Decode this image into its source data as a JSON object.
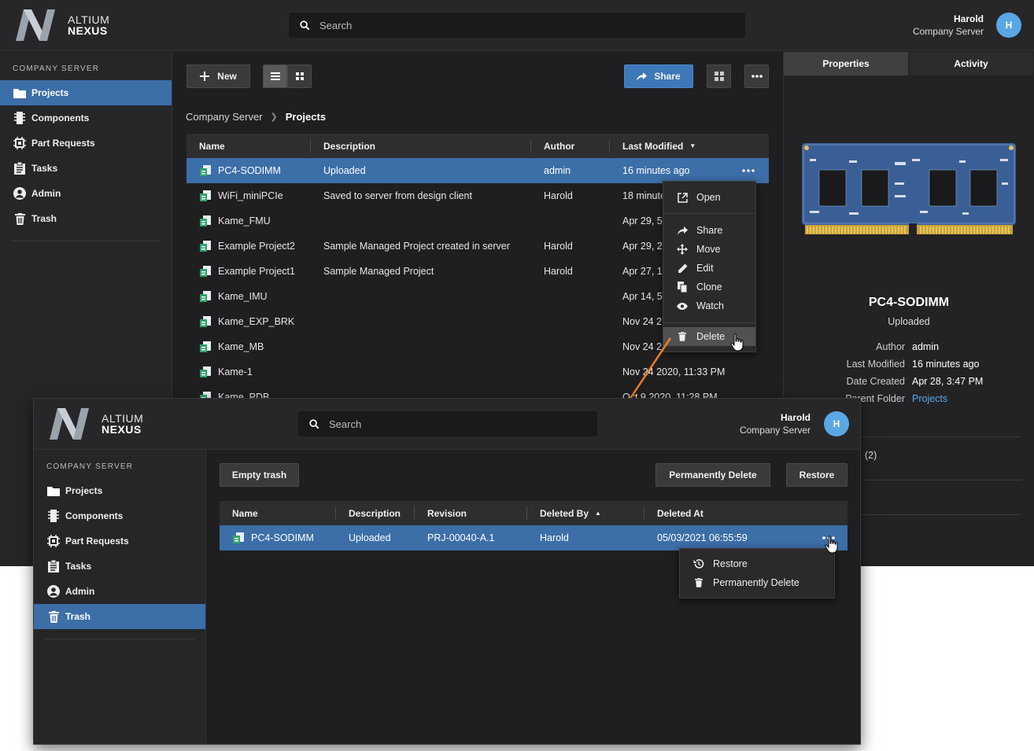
{
  "brand": {
    "line1": "ALTIUM",
    "line2": "NEXUS"
  },
  "search": {
    "placeholder": "Search"
  },
  "user": {
    "name": "Harold",
    "org": "Company Server",
    "initial": "H"
  },
  "sidebar": {
    "section": "COMPANY SERVER",
    "items": [
      {
        "label": "Projects",
        "icon": "folder-icon"
      },
      {
        "label": "Components",
        "icon": "chip-icon"
      },
      {
        "label": "Part Requests",
        "icon": "part-request-icon"
      },
      {
        "label": "Tasks",
        "icon": "clipboard-icon"
      },
      {
        "label": "Admin",
        "icon": "user-circle-icon"
      },
      {
        "label": "Trash",
        "icon": "trash-icon"
      }
    ]
  },
  "projects_view": {
    "toolbar": {
      "new_label": "New",
      "share_label": "Share"
    },
    "breadcrumb": {
      "root": "Company Server",
      "current": "Projects"
    },
    "columns": [
      "Name",
      "Description",
      "Author",
      "Last Modified"
    ],
    "rows": [
      {
        "name": "PC4-SODIMM",
        "description": "Uploaded",
        "author": "admin",
        "modified": "16 minutes ago"
      },
      {
        "name": "WiFi_miniPCIe",
        "description": "Saved to server from design client",
        "author": "Harold",
        "modified": "18 minutes ago"
      },
      {
        "name": "Kame_FMU",
        "description": "",
        "author": "",
        "modified": "Apr 29, 5"
      },
      {
        "name": "Example Project2",
        "description": "Sample Managed Project created in server",
        "author": "Harold",
        "modified": "Apr 29, 2"
      },
      {
        "name": "Example Project1",
        "description": "Sample Managed Project",
        "author": "Harold",
        "modified": "Apr 27, 1"
      },
      {
        "name": "Kame_IMU",
        "description": "",
        "author": "",
        "modified": "Apr 14, 5"
      },
      {
        "name": "Kame_EXP_BRK",
        "description": "",
        "author": "",
        "modified": "Nov 24 2"
      },
      {
        "name": "Kame_MB",
        "description": "",
        "author": "",
        "modified": "Nov 24 2"
      },
      {
        "name": "Kame-1",
        "description": "",
        "author": "",
        "modified": "Nov 24 2020, 11:33 PM"
      },
      {
        "name": "Kame_PDB",
        "description": "",
        "author": "",
        "modified": "Oct 9 2020, 11:28 PM"
      }
    ],
    "context_menu": [
      "Open",
      "Share",
      "Move",
      "Edit",
      "Clone",
      "Watch",
      "Delete"
    ]
  },
  "properties": {
    "tabs": [
      "Properties",
      "Activity"
    ],
    "name": "PC4-SODIMM",
    "description": "Uploaded",
    "fields": [
      {
        "key": "Author",
        "value": "admin"
      },
      {
        "key": "Last Modified",
        "value": "16 minutes ago"
      },
      {
        "key": "Date Created",
        "value": "Apr 28, 3:47 PM"
      },
      {
        "key": "Parent Folder",
        "value": "Projects"
      }
    ],
    "count_label": "(2)"
  },
  "trash_view": {
    "toolbar": {
      "empty_label": "Empty trash",
      "perm_delete_label": "Permanently Delete",
      "restore_label": "Restore"
    },
    "columns": [
      "Name",
      "Description",
      "Revision",
      "Deleted By",
      "Deleted At"
    ],
    "rows": [
      {
        "name": "PC4-SODIMM",
        "description": "Uploaded",
        "revision": "PRJ-00040-A.1",
        "deleted_by": "Harold",
        "deleted_at": "05/03/2021 06:55:59"
      }
    ],
    "context_menu": [
      "Restore",
      "Permanently Delete"
    ]
  },
  "colors": {
    "accent": "#3c6ea8",
    "link": "#5aa7e6",
    "arrow": "#f07a1e"
  }
}
